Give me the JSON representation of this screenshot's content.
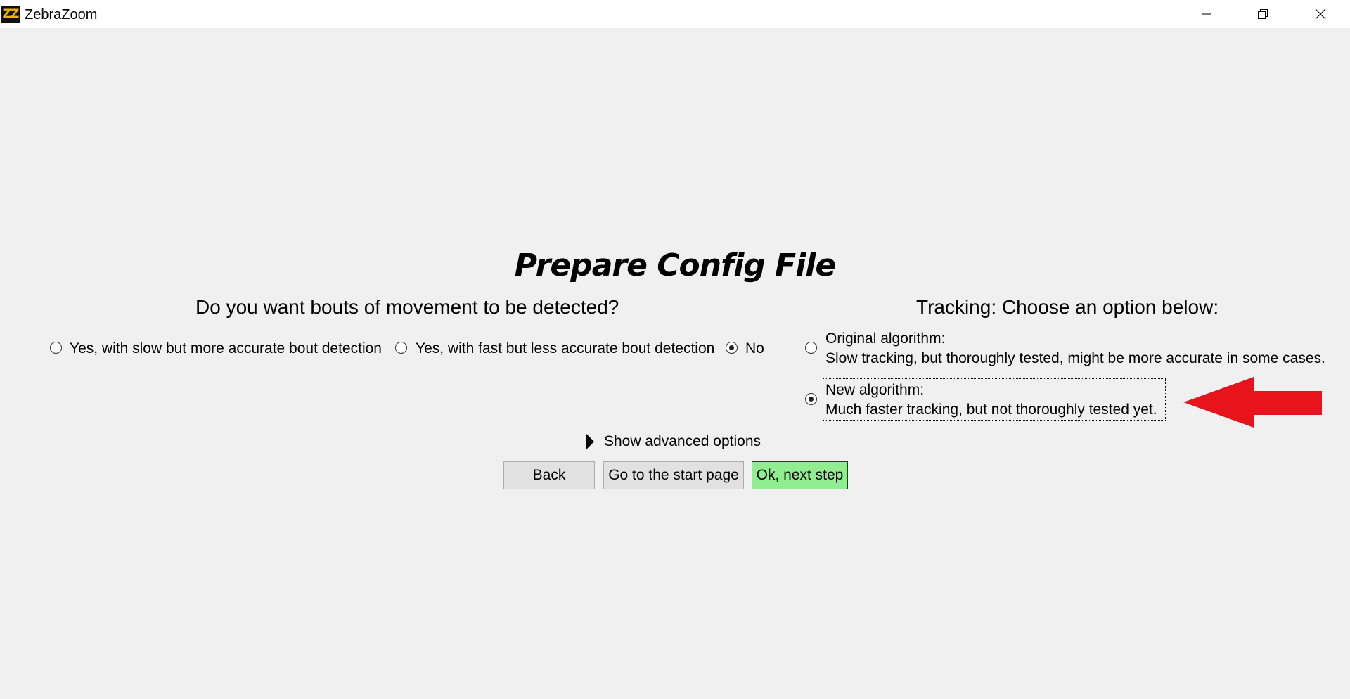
{
  "window": {
    "icon_text": "ZZ",
    "title": "ZebraZoom"
  },
  "page": {
    "title": "Prepare Config File"
  },
  "bouts": {
    "heading": "Do you want bouts of movement to be detected?",
    "options": [
      {
        "label": "Yes, with slow but more accurate bout detection",
        "checked": false
      },
      {
        "label": "Yes, with fast but less accurate bout detection",
        "checked": false
      },
      {
        "label": "No",
        "checked": true
      }
    ]
  },
  "tracking": {
    "heading": "Tracking: Choose an option below:",
    "options": [
      {
        "title": "Original algorithm:",
        "description": "Slow tracking, but thoroughly tested, might be more accurate in some cases.",
        "checked": false
      },
      {
        "title": "New algorithm:",
        "description": "Much faster tracking, but not thoroughly tested yet.",
        "checked": true
      }
    ]
  },
  "advanced": {
    "label": "Show advanced options"
  },
  "buttons": {
    "back": "Back",
    "start": "Go to the start page",
    "next": "Ok, next step"
  },
  "colors": {
    "next_button_bg": "#90ee90",
    "annotation_arrow": "#e8141c",
    "background": "#f0f0f0"
  }
}
